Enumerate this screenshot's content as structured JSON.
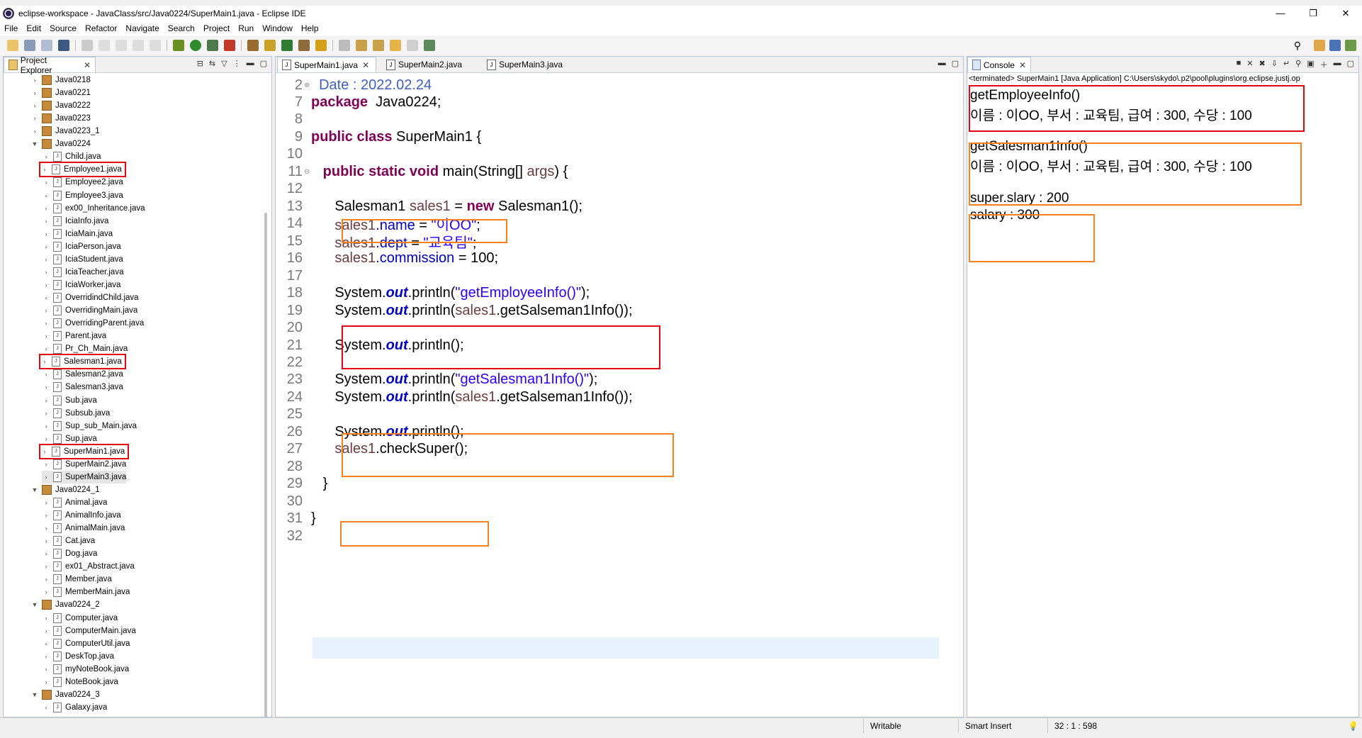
{
  "window": {
    "title": "eclipse-workspace - JavaClass/src/Java0224/SuperMain1.java - Eclipse IDE",
    "controls": {
      "minimize": "—",
      "maximize": "❐",
      "close": "✕"
    }
  },
  "menu": [
    "File",
    "Edit",
    "Source",
    "Refactor",
    "Navigate",
    "Search",
    "Project",
    "Run",
    "Window",
    "Help"
  ],
  "explorer": {
    "title": "Project Explorer",
    "items": [
      {
        "label": "Java0218",
        "level": 0,
        "kind": "pkg",
        "exp": false
      },
      {
        "label": "Java0221",
        "level": 0,
        "kind": "pkg",
        "exp": false
      },
      {
        "label": "Java0222",
        "level": 0,
        "kind": "pkg",
        "exp": false
      },
      {
        "label": "Java0223",
        "level": 0,
        "kind": "pkg",
        "exp": false
      },
      {
        "label": "Java0223_1",
        "level": 0,
        "kind": "pkg",
        "exp": false
      },
      {
        "label": "Java0224",
        "level": 0,
        "kind": "pkg",
        "exp": true
      },
      {
        "label": "Child.java",
        "level": 1,
        "kind": "file"
      },
      {
        "label": "Employee1.java",
        "level": 1,
        "kind": "file",
        "boxed": true
      },
      {
        "label": "Employee2.java",
        "level": 1,
        "kind": "file"
      },
      {
        "label": "Employee3.java",
        "level": 1,
        "kind": "file"
      },
      {
        "label": "ex00_Inheritance.java",
        "level": 1,
        "kind": "file"
      },
      {
        "label": "IciaInfo.java",
        "level": 1,
        "kind": "file"
      },
      {
        "label": "IciaMain.java",
        "level": 1,
        "kind": "file"
      },
      {
        "label": "IciaPerson.java",
        "level": 1,
        "kind": "file"
      },
      {
        "label": "IciaStudent.java",
        "level": 1,
        "kind": "file"
      },
      {
        "label": "IciaTeacher.java",
        "level": 1,
        "kind": "file"
      },
      {
        "label": "IciaWorker.java",
        "level": 1,
        "kind": "file"
      },
      {
        "label": "OverridindChild.java",
        "level": 1,
        "kind": "file"
      },
      {
        "label": "OverridingMain.java",
        "level": 1,
        "kind": "file"
      },
      {
        "label": "OverridingParent.java",
        "level": 1,
        "kind": "file"
      },
      {
        "label": "Parent.java",
        "level": 1,
        "kind": "file"
      },
      {
        "label": "Pr_Ch_Main.java",
        "level": 1,
        "kind": "file"
      },
      {
        "label": "Salesman1.java",
        "level": 1,
        "kind": "file",
        "boxed": true
      },
      {
        "label": "Salesman2.java",
        "level": 1,
        "kind": "file"
      },
      {
        "label": "Salesman3.java",
        "level": 1,
        "kind": "file"
      },
      {
        "label": "Sub.java",
        "level": 1,
        "kind": "file"
      },
      {
        "label": "Subsub.java",
        "level": 1,
        "kind": "file"
      },
      {
        "label": "Sup_sub_Main.java",
        "level": 1,
        "kind": "file"
      },
      {
        "label": "Sup.java",
        "level": 1,
        "kind": "file"
      },
      {
        "label": "SuperMain1.java",
        "level": 1,
        "kind": "file",
        "boxed": true
      },
      {
        "label": "SuperMain2.java",
        "level": 1,
        "kind": "file"
      },
      {
        "label": "SuperMain3.java",
        "level": 1,
        "kind": "file",
        "selected": true
      },
      {
        "label": "Java0224_1",
        "level": 0,
        "kind": "pkg",
        "exp": true
      },
      {
        "label": "Animal.java",
        "level": 1,
        "kind": "file"
      },
      {
        "label": "AnimalInfo.java",
        "level": 1,
        "kind": "file"
      },
      {
        "label": "AnimalMain.java",
        "level": 1,
        "kind": "file"
      },
      {
        "label": "Cat.java",
        "level": 1,
        "kind": "file"
      },
      {
        "label": "Dog.java",
        "level": 1,
        "kind": "file"
      },
      {
        "label": "ex01_Abstract.java",
        "level": 1,
        "kind": "file"
      },
      {
        "label": "Member.java",
        "level": 1,
        "kind": "file"
      },
      {
        "label": "MemberMain.java",
        "level": 1,
        "kind": "file"
      },
      {
        "label": "Java0224_2",
        "level": 0,
        "kind": "pkg",
        "exp": true
      },
      {
        "label": "Computer.java",
        "level": 1,
        "kind": "file"
      },
      {
        "label": "ComputerMain.java",
        "level": 1,
        "kind": "file"
      },
      {
        "label": "ComputerUtil.java",
        "level": 1,
        "kind": "file"
      },
      {
        "label": "DeskTop.java",
        "level": 1,
        "kind": "file"
      },
      {
        "label": "myNoteBook.java",
        "level": 1,
        "kind": "file"
      },
      {
        "label": "NoteBook.java",
        "level": 1,
        "kind": "file"
      },
      {
        "label": "Java0224_3",
        "level": 0,
        "kind": "pkg",
        "exp": true
      },
      {
        "label": "Galaxy.java",
        "level": 1,
        "kind": "file"
      }
    ]
  },
  "editor": {
    "tabs": [
      "SuperMain1.java",
      "SuperMain2.java",
      "SuperMain3.java"
    ],
    "lines": [
      {
        "n": "2",
        "fold": "⊕",
        "parts": [
          [
            "cmt",
            "  Date : 2022.02.24"
          ]
        ]
      },
      {
        "n": "7",
        "parts": [
          [
            "kw",
            "package"
          ],
          [
            "",
            "  Java0224;"
          ]
        ]
      },
      {
        "n": "8",
        "parts": []
      },
      {
        "n": "9",
        "parts": [
          [
            "kw",
            "public class"
          ],
          [
            "",
            " SuperMain1 {"
          ]
        ]
      },
      {
        "n": "10",
        "parts": []
      },
      {
        "n": "11",
        "fold": "⊖",
        "parts": [
          [
            "",
            "   "
          ],
          [
            "kw",
            "public static void"
          ],
          [
            "",
            " main(String[] "
          ],
          [
            "var",
            "args"
          ],
          [
            "",
            ") {"
          ]
        ]
      },
      {
        "n": "12",
        "parts": []
      },
      {
        "n": "13",
        "parts": [
          [
            "",
            "      Salesman1 "
          ],
          [
            "var",
            "sales1"
          ],
          [
            "",
            " = "
          ],
          [
            "kw",
            "new"
          ],
          [
            "",
            " Salesman1();"
          ]
        ]
      },
      {
        "n": "14",
        "parts": [
          [
            "",
            "      "
          ],
          [
            "var",
            "sales1"
          ],
          [
            "fld",
            ".name"
          ],
          [
            "",
            " = "
          ],
          [
            "str",
            "\"이OO\""
          ],
          [
            "",
            ";"
          ]
        ]
      },
      {
        "n": "15",
        "parts": [
          [
            "",
            "      "
          ],
          [
            "var",
            "sales1"
          ],
          [
            "fld",
            ".dept"
          ],
          [
            "",
            " = "
          ],
          [
            "str",
            "\"교육팀\""
          ],
          [
            "",
            ";"
          ]
        ]
      },
      {
        "n": "16",
        "parts": [
          [
            "",
            "      "
          ],
          [
            "var",
            "sales1"
          ],
          [
            "fld",
            ".commission"
          ],
          [
            "",
            " = 100;"
          ]
        ]
      },
      {
        "n": "17",
        "parts": []
      },
      {
        "n": "18",
        "parts": [
          [
            "",
            "      System."
          ],
          [
            "sta",
            "out"
          ],
          [
            "",
            ".println("
          ],
          [
            "str",
            "\"getEmployeeInfo()\""
          ],
          [
            "",
            ");"
          ]
        ]
      },
      {
        "n": "19",
        "parts": [
          [
            "",
            "      System."
          ],
          [
            "sta",
            "out"
          ],
          [
            "",
            ".println("
          ],
          [
            "var",
            "sales1"
          ],
          [
            "",
            ".getSalseman1Info());"
          ]
        ]
      },
      {
        "n": "20",
        "parts": []
      },
      {
        "n": "21",
        "parts": [
          [
            "",
            "      System."
          ],
          [
            "sta",
            "out"
          ],
          [
            "",
            ".println();"
          ]
        ]
      },
      {
        "n": "22",
        "parts": []
      },
      {
        "n": "23",
        "parts": [
          [
            "",
            "      System."
          ],
          [
            "sta",
            "out"
          ],
          [
            "",
            ".println("
          ],
          [
            "str",
            "\"getSalesman1Info()\""
          ],
          [
            "",
            ");"
          ]
        ]
      },
      {
        "n": "24",
        "parts": [
          [
            "",
            "      System."
          ],
          [
            "sta",
            "out"
          ],
          [
            "",
            ".println("
          ],
          [
            "var",
            "sales1"
          ],
          [
            "",
            ".getSalseman1Info());"
          ]
        ]
      },
      {
        "n": "25",
        "parts": []
      },
      {
        "n": "26",
        "parts": [
          [
            "",
            "      System."
          ],
          [
            "sta",
            "out"
          ],
          [
            "",
            ".println();"
          ]
        ]
      },
      {
        "n": "27",
        "parts": [
          [
            "",
            "      "
          ],
          [
            "var",
            "sales1"
          ],
          [
            "",
            ".checkSuper();"
          ]
        ]
      },
      {
        "n": "28",
        "parts": []
      },
      {
        "n": "29",
        "parts": [
          [
            "",
            "   }"
          ]
        ]
      },
      {
        "n": "30",
        "parts": []
      },
      {
        "n": "31",
        "parts": [
          [
            "",
            "}"
          ]
        ]
      },
      {
        "n": "32",
        "parts": []
      }
    ]
  },
  "console": {
    "title": "Console",
    "header": "<terminated> SuperMain1 [Java Application] C:\\Users\\skydo\\.p2\\pool\\plugins\\org.eclipse.justj.op",
    "output": [
      "getEmployeeInfo()",
      "이름 : 이OO, 부서 : 교육팀, 급여 : 300, 수당 : 100",
      "",
      "getSalesman1Info()",
      "이름 : 이OO, 부서 : 교육팀, 급여 : 300, 수당 : 100",
      "",
      "super.slary : 200",
      "salary : 300"
    ]
  },
  "status": {
    "writable": "Writable",
    "insert": "Smart Insert",
    "position": "32 : 1 : 598"
  },
  "colors": {
    "annotation_red": "#e30613",
    "annotation_orange": "#f7811f",
    "keyword": "#7f0055",
    "string": "#2a00ff",
    "field": "#0000c0"
  }
}
